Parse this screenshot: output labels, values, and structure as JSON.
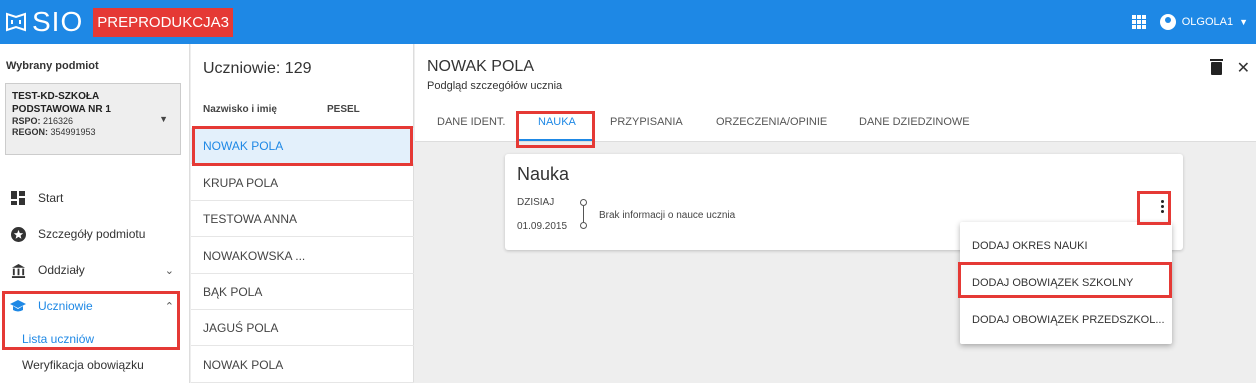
{
  "app": {
    "logo_text": "SIO",
    "env_badge": "PREPRODUKCJA3",
    "user": "OLGOLA1"
  },
  "sidebar": {
    "selected_label": "Wybrany podmiot",
    "entity": {
      "name": "TEST-KD-SZKOŁA PODSTAWOWA NR 1",
      "rspo_label": "RSPO:",
      "rspo": "216326",
      "regon_label": "REGON:",
      "regon": "354991953"
    },
    "items": [
      {
        "label": "Start",
        "icon": "dashboard-icon"
      },
      {
        "label": "Szczegóły podmiotu",
        "icon": "star-badge-icon"
      },
      {
        "label": "Oddziały",
        "icon": "building-icon"
      },
      {
        "label": "Uczniowie",
        "icon": "graduation-cap-icon"
      }
    ],
    "subitems": [
      {
        "label": "Lista uczniów"
      },
      {
        "label": "Weryfikacja obowiązku"
      }
    ]
  },
  "students": {
    "count_label": "Uczniowie: 129",
    "col_name": "Nazwisko i imię",
    "col_pesel": "PESEL",
    "rows": [
      "NOWAK POLA",
      "KRUPA POLA",
      "TESTOWA ANNA",
      "NOWAKOWSKA ...",
      "BĄK POLA",
      "JAGUŚ POLA",
      "NOWAK POLA"
    ]
  },
  "detail": {
    "title": "NOWAK POLA",
    "subtitle": "Podgląd szczegółów ucznia",
    "tabs": [
      "DANE IDENT.",
      "NAUKA",
      "PRZYPISANIA",
      "ORZECZENIA/OPINIE",
      "DANE DZIEDZINOWE"
    ],
    "card": {
      "title": "Nauka",
      "date_top": "DZISIAJ",
      "date_bottom": "01.09.2015",
      "info": "Brak informacji o nauce ucznia"
    },
    "menu": [
      "DODAJ OKRES NAUKI",
      "DODAJ OBOWIĄZEK SZKOLNY",
      "DODAJ OBOWIĄZEK PRZEDSZKOL..."
    ]
  },
  "colors": {
    "primary": "#1e88e5",
    "highlight": "#e53935"
  }
}
